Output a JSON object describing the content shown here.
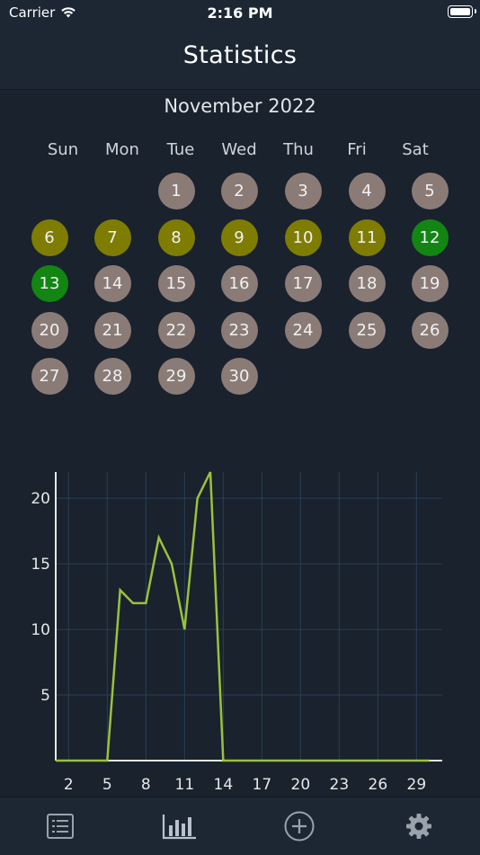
{
  "status_bar": {
    "carrier": "Carrier",
    "time": "2:16 PM"
  },
  "nav": {
    "title": "Statistics"
  },
  "calendar": {
    "month_label": "November 2022",
    "weekdays": [
      "Sun",
      "Mon",
      "Tue",
      "Wed",
      "Thu",
      "Fri",
      "Sat"
    ],
    "colors": {
      "default": "#8b7b77",
      "partial": "#7e7d02",
      "complete": "#128513"
    },
    "days": [
      {
        "label": "1",
        "status": "default"
      },
      {
        "label": "2",
        "status": "default"
      },
      {
        "label": "3",
        "status": "default"
      },
      {
        "label": "4",
        "status": "default"
      },
      {
        "label": "5",
        "status": "default"
      },
      {
        "label": "6",
        "status": "partial"
      },
      {
        "label": "7",
        "status": "partial"
      },
      {
        "label": "8",
        "status": "partial"
      },
      {
        "label": "9",
        "status": "partial"
      },
      {
        "label": "10",
        "status": "partial"
      },
      {
        "label": "11",
        "status": "partial"
      },
      {
        "label": "12",
        "status": "complete"
      },
      {
        "label": "13",
        "status": "complete"
      },
      {
        "label": "14",
        "status": "default"
      },
      {
        "label": "15",
        "status": "default"
      },
      {
        "label": "16",
        "status": "default"
      },
      {
        "label": "17",
        "status": "default"
      },
      {
        "label": "18",
        "status": "default"
      },
      {
        "label": "19",
        "status": "default"
      },
      {
        "label": "20",
        "status": "default"
      },
      {
        "label": "21",
        "status": "default"
      },
      {
        "label": "22",
        "status": "default"
      },
      {
        "label": "23",
        "status": "default"
      },
      {
        "label": "24",
        "status": "default"
      },
      {
        "label": "25",
        "status": "default"
      },
      {
        "label": "26",
        "status": "default"
      },
      {
        "label": "27",
        "status": "default"
      },
      {
        "label": "28",
        "status": "default"
      },
      {
        "label": "29",
        "status": "default"
      },
      {
        "label": "30",
        "status": "default"
      }
    ]
  },
  "chart_data": {
    "type": "line",
    "line_color": "#9ac13c",
    "grid": true,
    "xlim": [
      1,
      31
    ],
    "ylim": [
      0,
      22
    ],
    "xticks": [
      2,
      5,
      8,
      11,
      14,
      17,
      20,
      23,
      26,
      29
    ],
    "yticks": [
      5,
      10,
      15,
      20
    ],
    "x": [
      1,
      2,
      3,
      4,
      5,
      6,
      7,
      8,
      9,
      10,
      11,
      12,
      13,
      14,
      15,
      16,
      17,
      18,
      19,
      20,
      21,
      22,
      23,
      24,
      25,
      26,
      27,
      28,
      29,
      30
    ],
    "values": [
      0,
      0,
      0,
      0,
      0,
      13,
      12,
      12,
      17,
      15,
      10,
      20,
      22,
      0,
      0,
      0,
      0,
      0,
      0,
      0,
      0,
      0,
      0,
      0,
      0,
      0,
      0,
      0,
      0,
      0
    ]
  },
  "tabbar": {
    "items": [
      {
        "name": "list-icon",
        "active": false
      },
      {
        "name": "bar-chart-icon",
        "active": true
      },
      {
        "name": "add-circle-icon",
        "active": false
      },
      {
        "name": "gear-icon",
        "active": false
      }
    ]
  }
}
